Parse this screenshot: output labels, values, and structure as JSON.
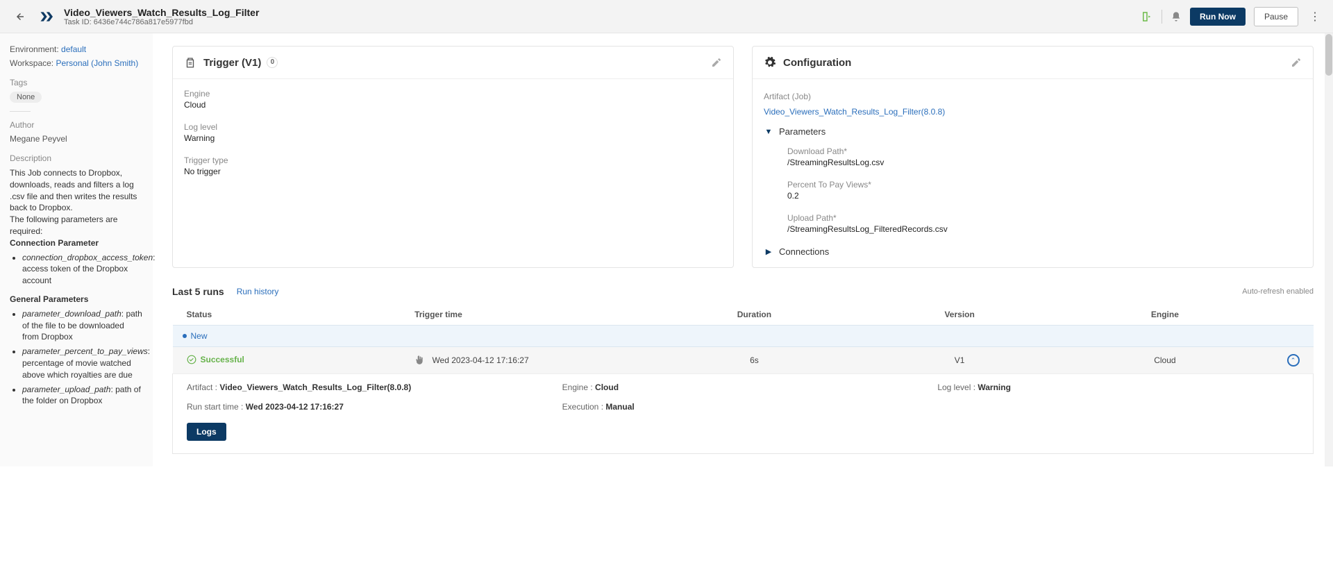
{
  "header": {
    "title": "Video_Viewers_Watch_Results_Log_Filter",
    "task_id_label": "Task ID: 6436e744c786a817e5977fbd",
    "run_now": "Run Now",
    "pause": "Pause"
  },
  "sidebar": {
    "env_label": "Environment:",
    "env_value": "default",
    "ws_label": "Workspace:",
    "ws_value": "Personal (John Smith)",
    "tags_label": "Tags",
    "tags_value": "None",
    "author_label": "Author",
    "author_value": "Megane Peyvel",
    "desc_label": "Description",
    "desc_body1": "This Job connects to Dropbox, downloads, reads and filters a log .csv file and then writes the results back to Dropbox.",
    "desc_body2": "The following parameters are required:",
    "conn_param_heading": "Connection Parameter",
    "conn_param_item_name": "connection_dropbox_access_token",
    "conn_param_item_desc": ": access token of the Dropbox account",
    "gen_param_heading": "General Parameters",
    "gen_param1_name": "parameter_download_path",
    "gen_param1_desc": ": path of the file to be downloaded from Dropbox",
    "gen_param2_name": "parameter_percent_to_pay_views",
    "gen_param2_desc": ": percentage of movie watched above which royalties are due",
    "gen_param3_name": "parameter_upload_path",
    "gen_param3_desc": ": path of the folder on Dropbox"
  },
  "trigger": {
    "card_title": "Trigger (V1)",
    "badge": "0",
    "engine_label": "Engine",
    "engine_value": "Cloud",
    "loglevel_label": "Log level",
    "loglevel_value": "Warning",
    "type_label": "Trigger type",
    "type_value": "No trigger"
  },
  "config": {
    "card_title": "Configuration",
    "artifact_label": "Artifact (Job)",
    "artifact_link": "Video_Viewers_Watch_Results_Log_Filter(8.0.8)",
    "params_label": "Parameters",
    "param1_label": "Download Path*",
    "param1_value": "/StreamingResultsLog.csv",
    "param2_label": "Percent To Pay Views*",
    "param2_value": "0.2",
    "param3_label": "Upload Path*",
    "param3_value": "/StreamingResultsLog_FilteredRecords.csv",
    "connections_label": "Connections"
  },
  "runs": {
    "title": "Last 5 runs",
    "history_link": "Run history",
    "auto_refresh": "Auto-refresh enabled",
    "col_status": "Status",
    "col_trigger": "Trigger time",
    "col_duration": "Duration",
    "col_version": "Version",
    "col_engine": "Engine",
    "new_label": "New",
    "row1": {
      "status": "Successful",
      "trigger_time": "Wed 2023-04-12 17:16:27",
      "duration": "6s",
      "version": "V1",
      "engine": "Cloud"
    },
    "detail": {
      "artifact_k": "Artifact : ",
      "artifact_v": "Video_Viewers_Watch_Results_Log_Filter(8.0.8)",
      "engine_k": "Engine : ",
      "engine_v": "Cloud",
      "loglevel_k": "Log level : ",
      "loglevel_v": "Warning",
      "start_k": "Run start time : ",
      "start_v": "Wed 2023-04-12 17:16:27",
      "exec_k": "Execution : ",
      "exec_v": "Manual",
      "logs_btn": "Logs"
    }
  }
}
